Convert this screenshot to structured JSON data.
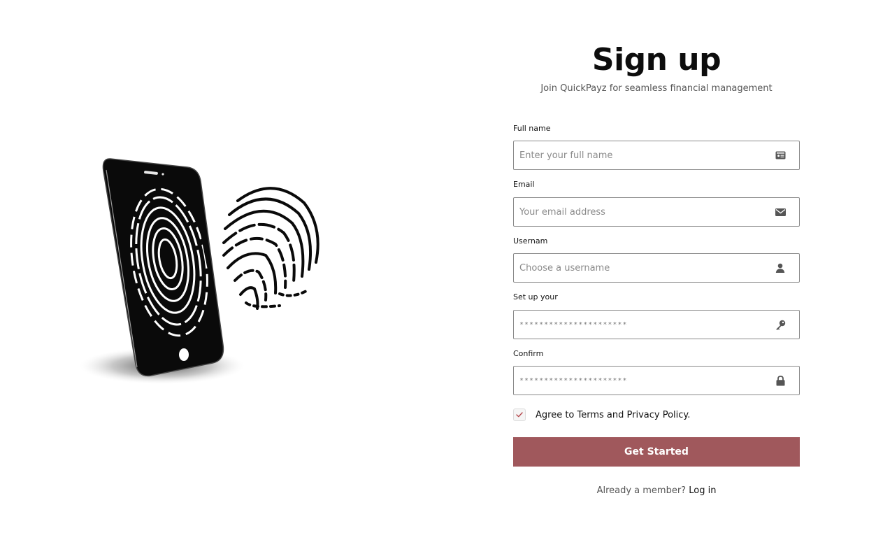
{
  "illustration": {
    "icon": "phone-fingerprint-illustration"
  },
  "header": {
    "title": "Sign up",
    "subtitle": "Join QuickPayz for seamless financial management"
  },
  "form": {
    "full_name": {
      "label": "Full name",
      "placeholder": "Enter your full name",
      "icon": "id-card-icon"
    },
    "email": {
      "label": "Email",
      "placeholder": "Your email address",
      "icon": "envelope-icon"
    },
    "username": {
      "label": "Usernam",
      "placeholder": "Choose a username",
      "icon": "user-icon"
    },
    "password": {
      "label": "Set up your",
      "value": "**********************",
      "icon": "key-icon"
    },
    "confirm": {
      "label": "Confirm",
      "value": "**********************",
      "icon": "lock-icon"
    },
    "agree": {
      "checked": true,
      "label": "Agree to Terms and Privacy Policy."
    },
    "submit_label": "Get Started"
  },
  "footer": {
    "prompt": "Already a member?",
    "login_label": "Log in"
  },
  "colors": {
    "accent": "#a0585c",
    "border": "#8a8a8a",
    "check": "#b5484d"
  }
}
